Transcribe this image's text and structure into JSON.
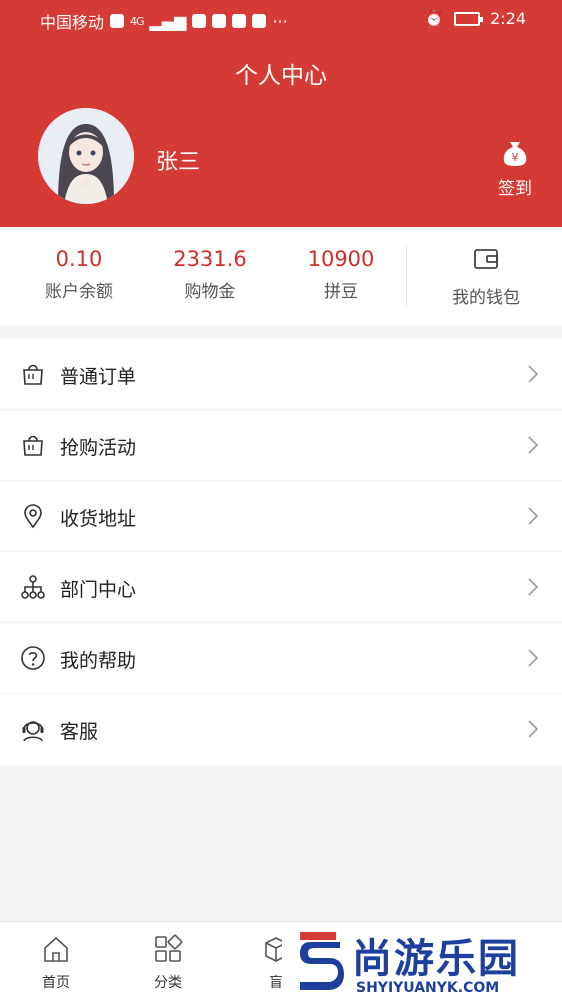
{
  "status_bar": {
    "carrier": "中国移动",
    "network": "4G",
    "time": "2:24"
  },
  "header": {
    "title": "个人中心",
    "user_name": "张三",
    "signin_label": "签到",
    "signin_icon": "money-bag-icon",
    "signin_symbol": "¥"
  },
  "stats": [
    {
      "value": "0.10",
      "label": "账户余额"
    },
    {
      "value": "2331.6",
      "label": "购物金"
    },
    {
      "value": "10900",
      "label": "拼豆"
    }
  ],
  "wallet": {
    "label": "我的钱包",
    "icon": "wallet-icon"
  },
  "menu": [
    {
      "label": "普通订单",
      "icon": "shopping-bag-icon"
    },
    {
      "label": "抢购活动",
      "icon": "shopping-bag-icon"
    },
    {
      "label": "收货地址",
      "icon": "location-pin-icon"
    },
    {
      "label": "部门中心",
      "icon": "org-chart-icon"
    },
    {
      "label": "我的帮助",
      "icon": "help-icon"
    },
    {
      "label": "客服",
      "icon": "headset-icon"
    }
  ],
  "tabbar": [
    {
      "label": "首页",
      "icon": "home-icon"
    },
    {
      "label": "分类",
      "icon": "grid-icon"
    },
    {
      "label": "盲",
      "icon": "box-icon"
    }
  ],
  "watermark": {
    "text": "尚游乐园",
    "url": "SHYIYUANYK.COM"
  },
  "colors": {
    "primary": "#d63a35",
    "stat_value": "#cf2e2b",
    "background": "#f3f2f5",
    "watermark": "#1d3f9e"
  }
}
